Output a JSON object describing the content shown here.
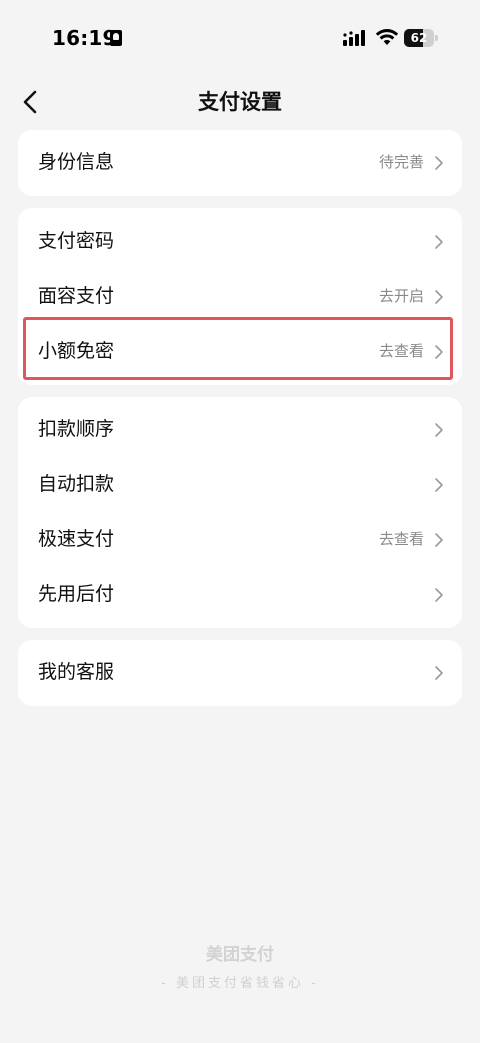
{
  "status_bar": {
    "time": "16:19",
    "battery": "62",
    "battery_level": 0.62
  },
  "nav": {
    "title": "支付设置",
    "back_icon": "chevron-left-icon"
  },
  "sections": [
    {
      "rows": [
        {
          "label": "身份信息",
          "value": "待完善"
        }
      ]
    },
    {
      "rows": [
        {
          "label": "支付密码",
          "value": ""
        },
        {
          "label": "面容支付",
          "value": "去开启"
        },
        {
          "label": "小额免密",
          "value": "去查看"
        }
      ]
    },
    {
      "rows": [
        {
          "label": "扣款顺序",
          "value": ""
        },
        {
          "label": "自动扣款",
          "value": ""
        },
        {
          "label": "极速支付",
          "value": "去查看"
        },
        {
          "label": "先用后付",
          "value": ""
        }
      ]
    },
    {
      "rows": [
        {
          "label": "我的客服",
          "value": ""
        }
      ]
    }
  ],
  "highlight_color": "#e0565b",
  "footer": {
    "brand": "美团支付",
    "slogan": "- 美团支付省钱省心 -"
  }
}
